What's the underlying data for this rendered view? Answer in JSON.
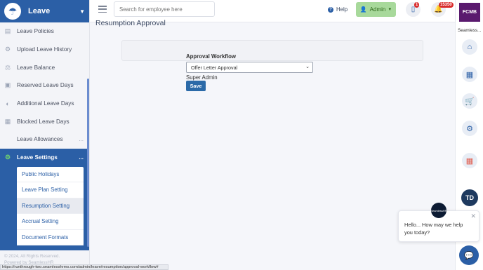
{
  "sidebar": {
    "module_title": "Leave",
    "items": [
      {
        "label": "Leave Policies",
        "icon": "document-icon"
      },
      {
        "label": "Upload Leave History",
        "icon": "gear-icon"
      },
      {
        "label": "Leave Balance",
        "icon": "scale-icon"
      },
      {
        "label": "Reserved Leave Days",
        "icon": "lock-icon"
      },
      {
        "label": "Additional Leave Days",
        "icon": "shield-icon"
      },
      {
        "label": "Blocked Leave Days",
        "icon": "calendar-icon"
      },
      {
        "label": "Leave Allowances",
        "icon": "none",
        "dots": "..."
      },
      {
        "label": "Leave Settings",
        "icon": "gear-icon",
        "dots": "..."
      }
    ],
    "submenu": [
      {
        "label": "Public Holidays"
      },
      {
        "label": "Leave Plan Setting"
      },
      {
        "label": "Resumption Setting"
      },
      {
        "label": "Accrual Setting"
      },
      {
        "label": "Document Formats"
      }
    ],
    "footer_line1": "© 2024, All Rights Reserved.",
    "footer_line2": "Powered by SeamlessHR"
  },
  "topbar": {
    "search_placeholder": "Search for employee here",
    "help_label": "Help",
    "admin_label": "Admin",
    "clipboard_badge": "1",
    "bell_badge": "15350"
  },
  "rail": {
    "brand": "FCMB",
    "company": "Seamless...",
    "avatar_initials": "TD"
  },
  "main": {
    "page_title": "Resumption Approval",
    "workflow_label": "Approval Workflow",
    "workflow_selected": "Offer Letter Approval",
    "approver": "Super Admin",
    "save_label": "Save"
  },
  "chat": {
    "message": "Hello... How may we help you today?",
    "avatar_text": "SeamlessHR"
  },
  "status_url": "https://runthrough-two.seamlesshrms.com/admin/leave/resumption/approval-workflow#"
}
